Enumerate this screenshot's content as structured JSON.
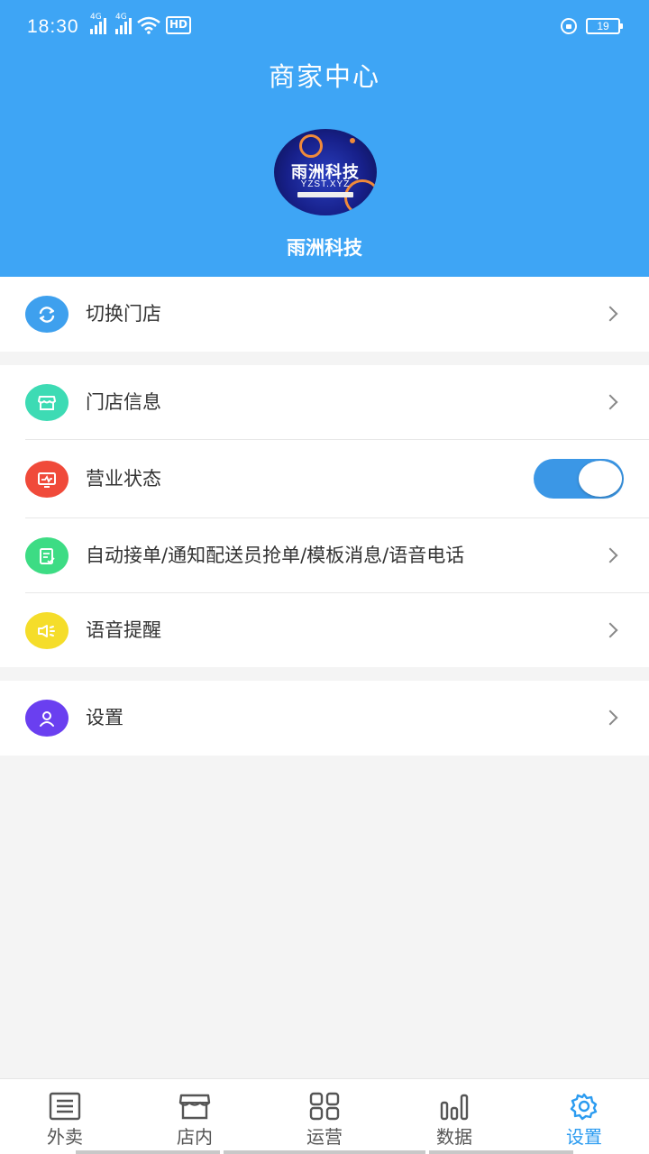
{
  "status_bar": {
    "time": "18:30",
    "sim1_label": "4G",
    "sim2_label": "4G",
    "hd_label": "HD",
    "battery": "19"
  },
  "header": {
    "title": "商家中心",
    "logo_text": "雨洲科技",
    "logo_subtext": "YZST.XYZ",
    "store_name": "雨洲科技",
    "background_color": "#3ea5f5"
  },
  "menu_groups": [
    {
      "items": [
        {
          "label": "切换门店",
          "icon": "switch-store-icon",
          "icon_color": "#3ea0ee"
        }
      ]
    },
    {
      "items": [
        {
          "label": "门店信息",
          "icon": "store-info-icon",
          "icon_color": "#3ddbb4"
        },
        {
          "label": "营业状态",
          "icon": "business-status-icon",
          "icon_color": "#f04a3a",
          "toggle_on": true
        },
        {
          "label": "自动接单/通知配送员抢单/模板消息/语音电话",
          "icon": "auto-order-icon",
          "icon_color": "#3ddc84"
        },
        {
          "label": "语音提醒",
          "icon": "voice-reminder-icon",
          "icon_color": "#f5dd2a"
        }
      ]
    },
    {
      "items": [
        {
          "label": "设置",
          "icon": "user-settings-icon",
          "icon_color": "#6a3ff0"
        }
      ]
    }
  ],
  "tabbar": {
    "tabs": [
      {
        "label": "外卖",
        "icon": "takeout-icon"
      },
      {
        "label": "店内",
        "icon": "store-icon"
      },
      {
        "label": "运营",
        "icon": "grid-icon"
      },
      {
        "label": "数据",
        "icon": "bar-chart-icon"
      },
      {
        "label": "设置",
        "icon": "gear-icon",
        "active": true
      }
    ],
    "active_color": "#2b9bf0"
  }
}
